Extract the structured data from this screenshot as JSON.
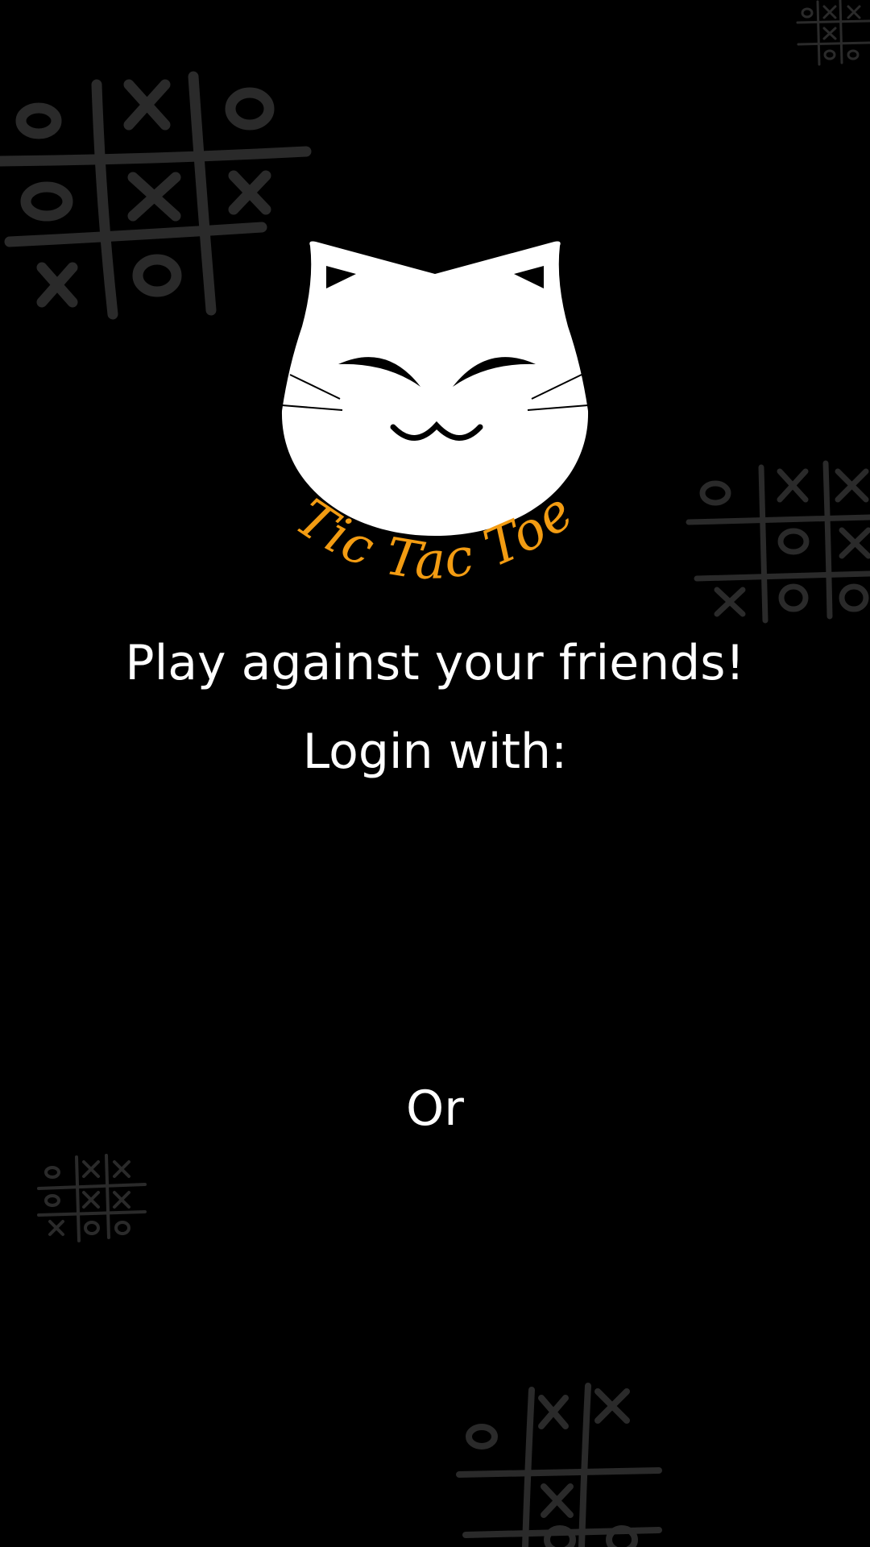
{
  "logo": {
    "wordmark": "Tic Tac Toe",
    "wordmark_color": "#f39c12",
    "face_color": "#ffffff"
  },
  "main": {
    "tagline": "Play against your friends!",
    "login_label": "Login with:",
    "or_label": "Or"
  },
  "theme": {
    "background": "#000000",
    "text": "#ffffff",
    "decor_lines": "#2a2a2a"
  }
}
